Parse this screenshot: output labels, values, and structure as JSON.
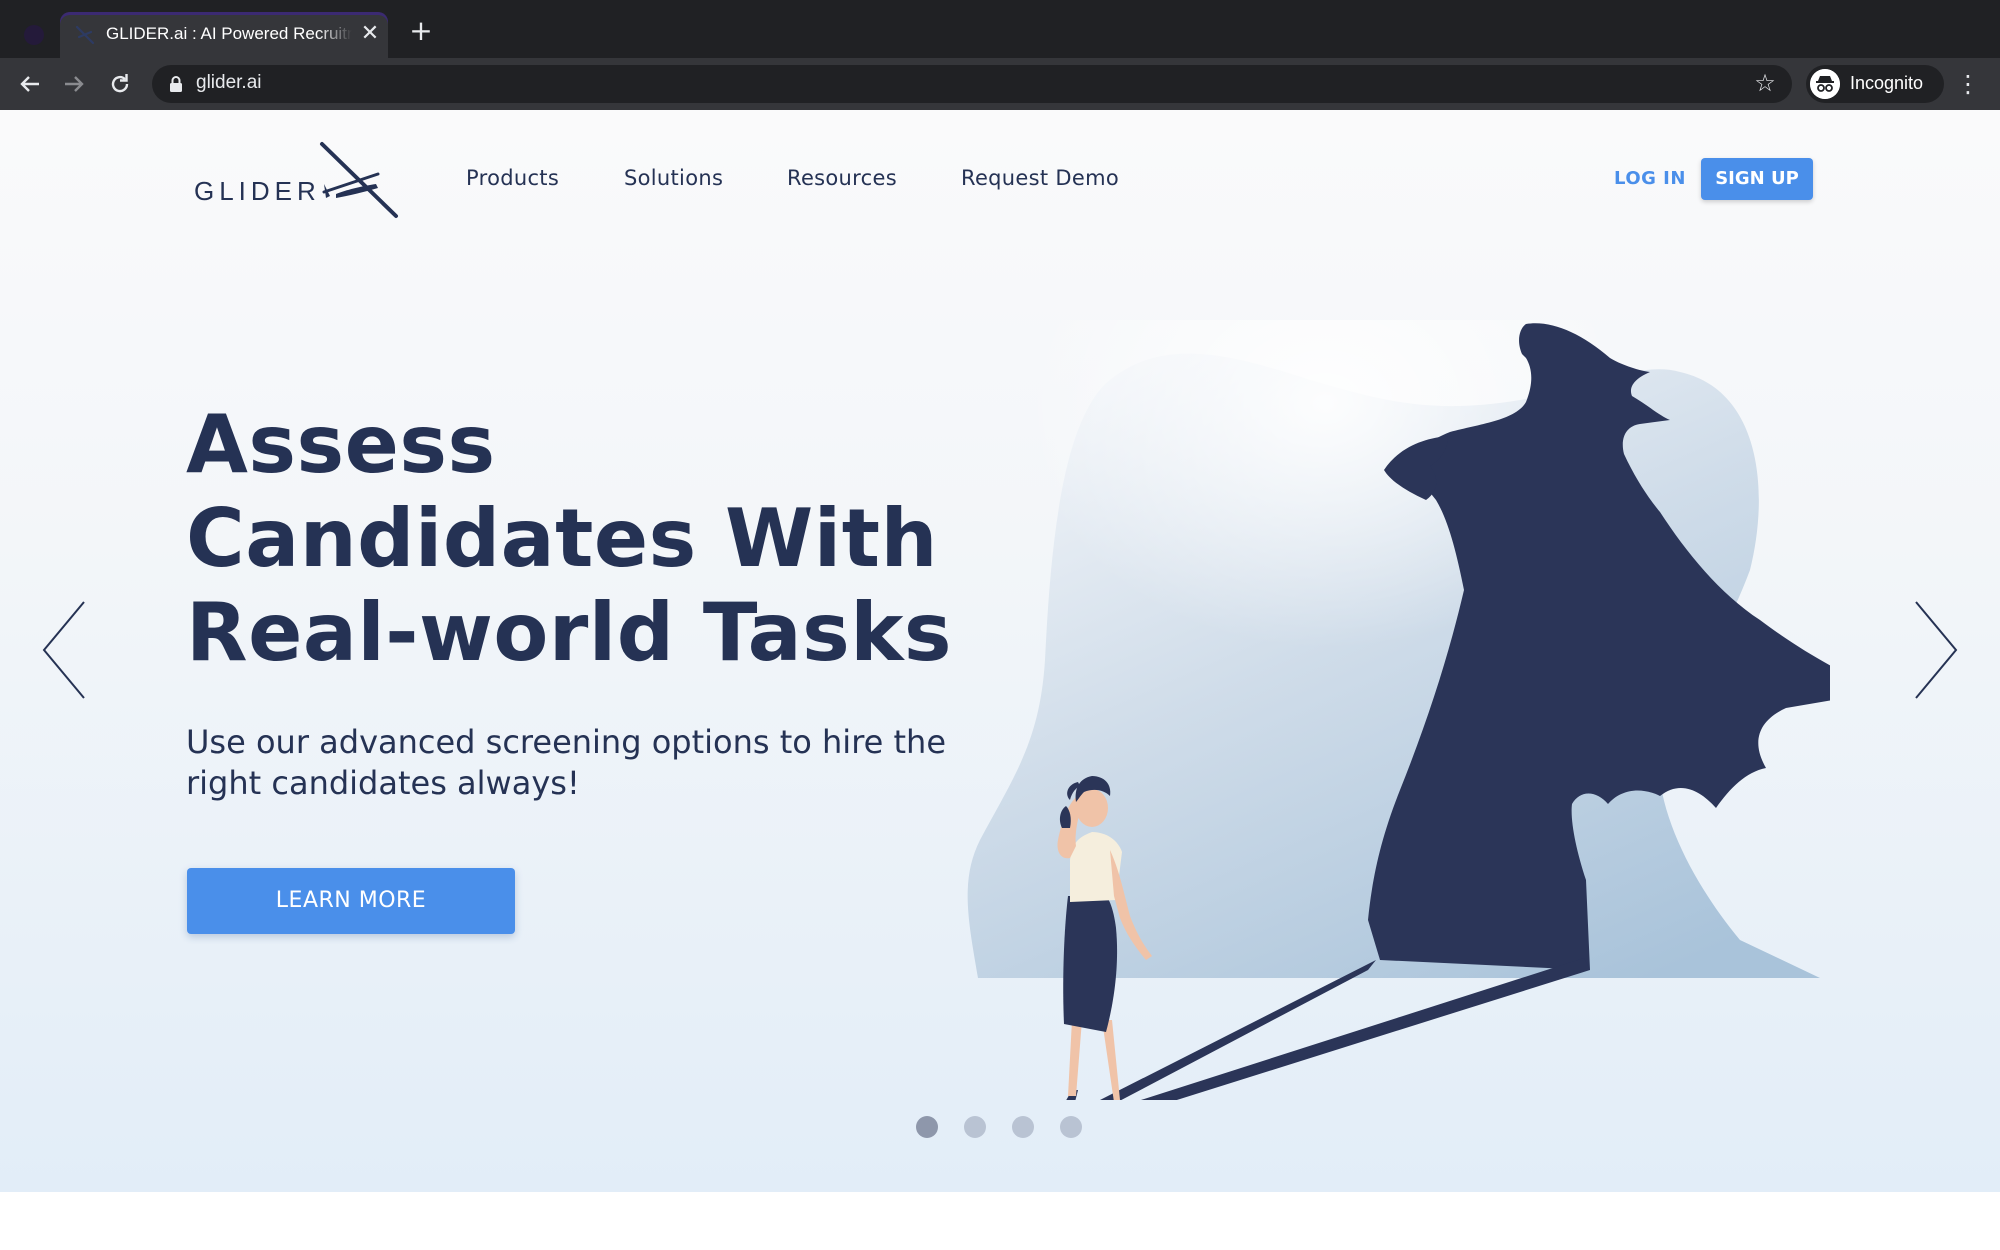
{
  "browser": {
    "tab_title": "GLIDER.ai : AI Powered Recruitment",
    "tab_close": "✕",
    "new_tab": "+",
    "url": "glider.ai",
    "incognito_label": "Incognito",
    "icons": [
      "back-arrow-icon",
      "forward-arrow-icon",
      "reload-icon",
      "lock-icon",
      "star-icon",
      "incognito-icon",
      "kebab-menu-icon"
    ]
  },
  "header": {
    "logo_text": "GLIDER",
    "nav": [
      "Products",
      "Solutions",
      "Resources",
      "Request Demo"
    ],
    "login_label": "LOG IN",
    "signup_label": "SIGN UP"
  },
  "hero": {
    "headline": [
      "Assess",
      "Candidates With",
      "Real-world Tasks"
    ],
    "subline": [
      "Use our advanced screening options to hire the",
      "right candidates always!"
    ],
    "cta_label": "LEARN MORE",
    "slides_total": 4,
    "active_slide": 1
  },
  "colors": {
    "navy": "#253254",
    "accent": "#4a8fea",
    "dot": "#b9c3d3",
    "dot_active": "#8e97ab"
  }
}
